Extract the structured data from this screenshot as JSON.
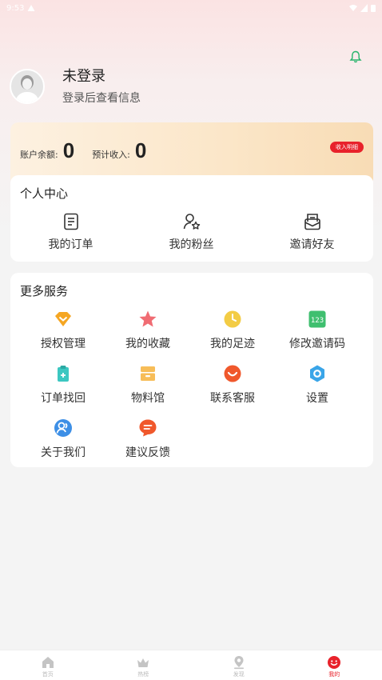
{
  "status_bar": {
    "time": "9:53",
    "left_icon": "warning-icon",
    "right_icons": [
      "wifi-icon",
      "signal-icon",
      "battery-icon"
    ]
  },
  "header": {
    "bell_icon": "bell-icon",
    "bell_color": "#25b36a"
  },
  "profile": {
    "name": "未登录",
    "subtitle": "登录后查看信息",
    "avatar_icon": "avatar-icon"
  },
  "balance": {
    "balance_label": "账户余额:",
    "balance_value": "0",
    "income_label": "预计收入:",
    "income_value": "0",
    "detail_button": "收入明细",
    "accent": "#e8222b"
  },
  "personal_center": {
    "title": "个人中心",
    "items": [
      {
        "label": "我的订单",
        "icon": "order-icon"
      },
      {
        "label": "我的粉丝",
        "icon": "fans-icon"
      },
      {
        "label": "邀请好友",
        "icon": "invite-icon"
      }
    ]
  },
  "services": {
    "title": "更多服务",
    "items": [
      {
        "label": "授权管理",
        "icon": "authorize-icon",
        "color": "#f5a623"
      },
      {
        "label": "我的收藏",
        "icon": "star-icon",
        "color": "#f06c73"
      },
      {
        "label": "我的足迹",
        "icon": "clock-icon",
        "color": "#f3cc45"
      },
      {
        "label": "修改邀请码",
        "icon": "code-icon",
        "color": "#3fbf6f"
      },
      {
        "label": "订单找回",
        "icon": "clipboard-icon",
        "color": "#3cc7c1"
      },
      {
        "label": "物料馆",
        "icon": "box-icon",
        "color": "#f7bd58"
      },
      {
        "label": "联系客服",
        "icon": "service-icon",
        "color": "#f0582c"
      },
      {
        "label": "设置",
        "icon": "settings-icon",
        "color": "#3aa5e8"
      },
      {
        "label": "关于我们",
        "icon": "about-icon",
        "color": "#3d8fe6"
      },
      {
        "label": "建议反馈",
        "icon": "feedback-icon",
        "color": "#f0582c"
      }
    ]
  },
  "bottom_nav": {
    "items": [
      {
        "label": "首页",
        "icon": "home-icon"
      },
      {
        "label": "热榜",
        "icon": "crown-icon"
      },
      {
        "label": "发现",
        "icon": "location-icon"
      },
      {
        "label": "我的",
        "icon": "profile-icon",
        "active": true
      }
    ]
  }
}
